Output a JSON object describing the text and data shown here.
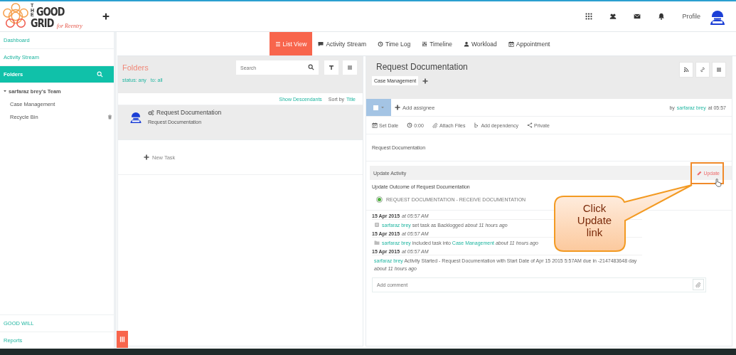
{
  "logo": {
    "the": "THE",
    "good": "GOOD",
    "grid": "GRID",
    "tagline": "for Reentry"
  },
  "header": {
    "profile": "Profile"
  },
  "sidebar": {
    "items": [
      {
        "label": "Dashboard",
        "selected": false
      },
      {
        "label": "Activity Stream",
        "selected": false
      },
      {
        "label": "Folders",
        "selected": true
      }
    ],
    "tree": [
      {
        "label": "sarfaraz brey's Team",
        "expanded": true,
        "children": [
          {
            "label": "Case Management",
            "kind": "folder"
          },
          {
            "label": "Recycle Bin",
            "kind": "trash"
          }
        ]
      }
    ],
    "bottom_items": [
      {
        "label": "GOOD WILL"
      },
      {
        "label": "Reports"
      }
    ]
  },
  "tabs": [
    {
      "label": "List View",
      "selected": true
    },
    {
      "label": "Activity Stream",
      "selected": false
    },
    {
      "label": "Time Log",
      "selected": false
    },
    {
      "label": "Timeline",
      "selected": false
    },
    {
      "label": "Workload",
      "selected": false
    },
    {
      "label": "Appointment",
      "selected": false
    }
  ],
  "folders": {
    "title": "Folders",
    "search": {
      "placeholder": "Search"
    },
    "filters": [
      "status: any",
      "to: all"
    ],
    "show_descendants": "Show Descendants",
    "sort_label": "Sort by",
    "sort_value": "Title",
    "tasks": [
      {
        "title": "Request Documentation",
        "subtitle": "Request Documentation",
        "selected": true
      }
    ],
    "new_task": "New Task"
  },
  "task": {
    "title": "Request Documentation",
    "tags": [
      "Case Management"
    ],
    "checked": false,
    "add_assignee": "Add assignee",
    "by": "by",
    "author": "sarfaraz brey",
    "at": "at 05:57",
    "actions": [
      "Set Date",
      "0:00",
      "Attach Files",
      "Add dependency",
      "Private"
    ],
    "description": "Request Documentation",
    "update_activity": "Update Activity",
    "update_link": "Update",
    "outcome_title": "Update Outcome of Request Documentation",
    "outcomes": [
      {
        "label": "REQUEST DOCUMENTATION - RECEIVE DOCUMENTATION",
        "selected": true
      }
    ],
    "log": [
      {
        "date": "15 Apr 2015",
        "time": "at 05:57 AM",
        "kind": "status",
        "parts": [
          {
            "kind": "link",
            "text": "sarfaraz brey"
          },
          {
            "kind": "text",
            "text": "set task as Backlogged"
          }
        ],
        "ago": "about 11 hours ago"
      },
      {
        "date": "15 Apr 2015",
        "time": "at 05:57 AM",
        "kind": "folder",
        "parts": [
          {
            "kind": "link",
            "text": "sarfaraz brey"
          },
          {
            "kind": "text",
            "text": "included task into"
          },
          {
            "kind": "link",
            "text": "Case Management"
          }
        ],
        "ago": "about 11 hours ago"
      },
      {
        "date": "15 Apr 2015",
        "time": "at 05:57 AM",
        "kind": "plain",
        "parts": [
          {
            "kind": "link",
            "text": "sarfaraz brey"
          },
          {
            "kind": "text",
            "text": "Activity Started - Request Documentation with Start Date of Apr 15 2015 5:57AM due in -2147483648 day"
          }
        ],
        "ago": "about 11 hours ago"
      }
    ],
    "comment": {
      "placeholder": "Add comment"
    }
  },
  "callout": {
    "text": "Click Update link"
  }
}
